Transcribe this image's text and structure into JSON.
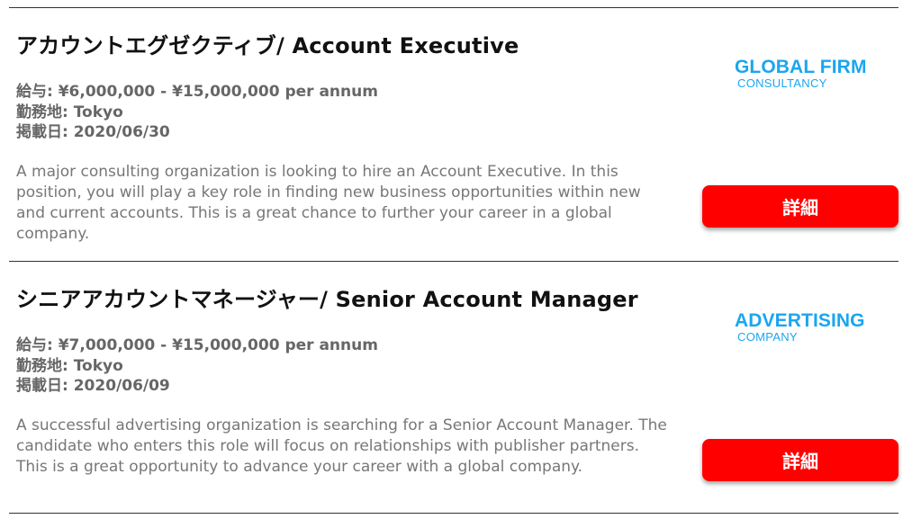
{
  "jobs": [
    {
      "title": "アカウントエグゼクティブ/ Account Executive",
      "salary": "給与: ¥6,000,000 - ¥15,000,000 per annum",
      "location": "勤務地: Tokyo",
      "posted": "掲載日: 2020/06/30",
      "description": "A major consulting organization is looking to hire an Account Executive. In this position, you will play a key role in finding new business opportunities within new and current accounts. This is a great chance to further your career in a global company.",
      "logo_name": "GLOBAL FIRM",
      "logo_sub": "CONSULTANCY",
      "button_label": "詳細"
    },
    {
      "title": "シニアアカウントマネージャー/ Senior Account Manager",
      "salary": "給与: ¥7,000,000 - ¥15,000,000 per annum",
      "location": "勤務地: Tokyo",
      "posted": "掲載日: 2020/06/09",
      "description": "A successful advertising organization is searching for a Senior Account Manager. The candidate who enters this role will focus on relationships with publisher partners. This is a great opportunity to advance your career with a global company.",
      "logo_name": "ADVERTISING",
      "logo_sub": "COMPANY",
      "button_label": "詳細"
    }
  ],
  "colors": {
    "button": "#ff0000",
    "logo": "#1aa6f0"
  }
}
